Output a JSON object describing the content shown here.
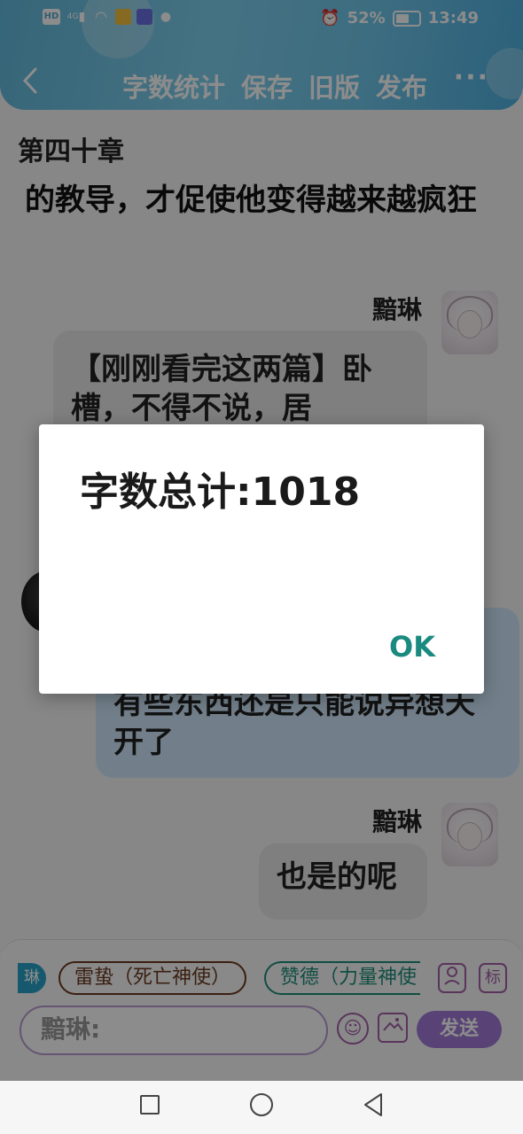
{
  "status_bar": {
    "network": "4G",
    "battery": "52%",
    "time": "13:49",
    "icons": [
      "hd-icon",
      "signal-icon",
      "wifi-icon",
      "note-app-icon",
      "music-app-icon",
      "wechat-icon",
      "alarm-icon",
      "battery-icon"
    ]
  },
  "header": {
    "actions": [
      "字数统计",
      "保存",
      "旧版",
      "发布"
    ],
    "back_icon": "chevron-left-icon",
    "more_icon": "more-horizontal-icon"
  },
  "content": {
    "chapter_title": "第四十章",
    "paragraph": "的教导，才促使他变得越来越疯狂",
    "messages": [
      {
        "speaker": "黯琳",
        "text": "【刚刚看完这两篇】卧槽，不得不说，居"
      },
      {
        "speaker": "",
        "text": "有些东西还是只能说异想天开了"
      },
      {
        "speaker": "黯琳",
        "text": "也是的呢"
      }
    ]
  },
  "composer": {
    "active_chip": "琳",
    "chips": [
      "雷蛰（死亡神使）",
      "赞德（力量神使"
    ],
    "tool_labels": [
      "标"
    ],
    "input_prefix": "黯琳:",
    "send_label": "发送"
  },
  "dialog": {
    "message": "字数总计:1018",
    "ok_label": "OK"
  },
  "colors": {
    "header_accent": "#6fc6ea",
    "dialog_button": "#1a8a80",
    "send_button": "#a27ad8"
  }
}
